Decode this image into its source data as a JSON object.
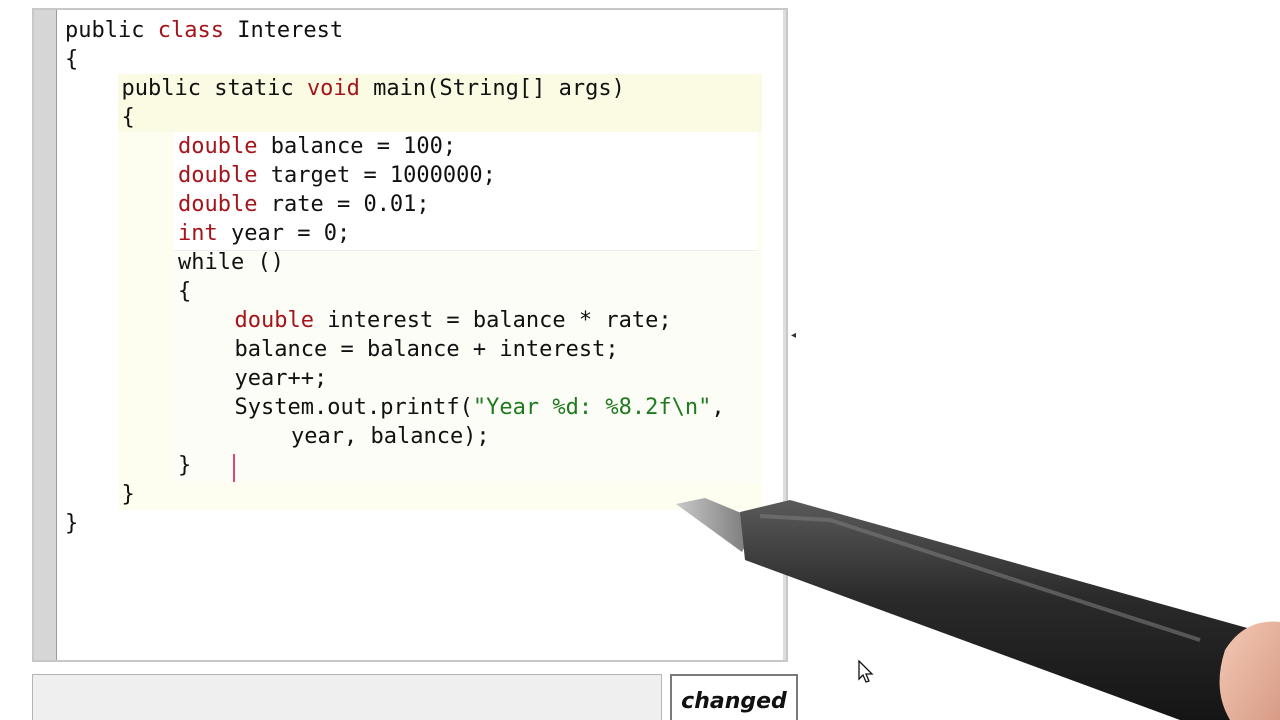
{
  "editor": {
    "lines": [
      {
        "indent": 0,
        "segments": [
          {
            "t": "public ",
            "k": false
          },
          {
            "t": "class",
            "k": true
          },
          {
            "t": " Interest",
            "k": false
          }
        ]
      },
      {
        "indent": 0,
        "segments": [
          {
            "t": "{",
            "k": false
          }
        ]
      },
      {
        "indent": 1,
        "segments": [
          {
            "t": "public static ",
            "k": false
          },
          {
            "t": "void",
            "k": true
          },
          {
            "t": " main(String[] args)",
            "k": false
          }
        ]
      },
      {
        "indent": 1,
        "segments": [
          {
            "t": "{",
            "k": false
          }
        ]
      },
      {
        "indent": 2,
        "segments": [
          {
            "t": "double",
            "k": true
          },
          {
            "t": " balance = 100;",
            "k": false
          }
        ]
      },
      {
        "indent": 2,
        "segments": [
          {
            "t": "double",
            "k": true
          },
          {
            "t": " target = 1000000;",
            "k": false
          }
        ]
      },
      {
        "indent": 2,
        "segments": [
          {
            "t": "double",
            "k": true
          },
          {
            "t": " rate = 0.01;",
            "k": false
          }
        ]
      },
      {
        "indent": 2,
        "segments": [
          {
            "t": "int",
            "k": true
          },
          {
            "t": " year = 0;",
            "k": false
          }
        ]
      },
      {
        "indent": 2,
        "segments": [
          {
            "t": "while ()",
            "k": false
          }
        ]
      },
      {
        "indent": 2,
        "segments": [
          {
            "t": "{",
            "k": false
          }
        ]
      },
      {
        "indent": 3,
        "segments": [
          {
            "t": "double",
            "k": true
          },
          {
            "t": " interest = balance * rate;",
            "k": false
          }
        ]
      },
      {
        "indent": 3,
        "segments": [
          {
            "t": "balance = balance + interest;",
            "k": false
          }
        ]
      },
      {
        "indent": 3,
        "segments": [
          {
            "t": "year++;",
            "k": false
          }
        ]
      },
      {
        "indent": 3,
        "segments": [
          {
            "t": "System.out.printf(",
            "k": false
          },
          {
            "t": "\"Year %d: %8.2f\\n\"",
            "k": false,
            "s": true
          },
          {
            "t": ",",
            "k": false
          }
        ]
      },
      {
        "indent": 4,
        "segments": [
          {
            "t": "year, balance);",
            "k": false
          }
        ]
      },
      {
        "indent": 2,
        "segments": [
          {
            "t": "}",
            "k": false
          }
        ]
      },
      {
        "indent": 1,
        "segments": [
          {
            "t": "}",
            "k": false
          }
        ]
      },
      {
        "indent": 0,
        "segments": [
          {
            "t": "}",
            "k": false
          }
        ]
      }
    ]
  },
  "status": {
    "message": "",
    "badge_label": "changed"
  },
  "colors": {
    "keyword": "#a3151b",
    "string": "#1f7a1f",
    "text": "#111111",
    "cursor": "#e2456e"
  },
  "icons": {
    "collapse": "collapse-arrow-icon",
    "pointer": "mouse-pointer-icon"
  }
}
